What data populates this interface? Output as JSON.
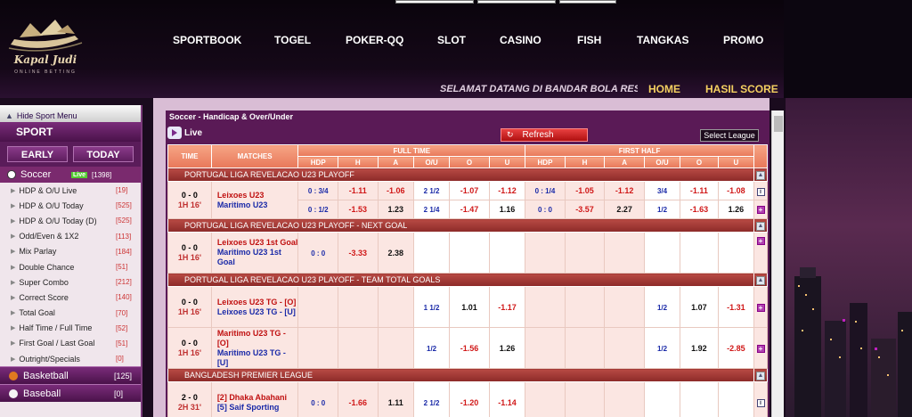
{
  "brand": {
    "name": "Kapal Judi",
    "tagline": "ONLINE BETTING"
  },
  "nav": [
    "SPORTBOOK",
    "TOGEL",
    "POKER-QQ",
    "SLOT",
    "CASINO",
    "FISH",
    "TANGKAS",
    "PROMO"
  ],
  "marquee": "SELAMAT DATANG DI BANDAR BOLA RESMI",
  "header_links": {
    "home": "HOME",
    "results": "HASIL SCORE"
  },
  "sidebar": {
    "hide_label": "Hide Sport Menu",
    "sport_title": "SPORT",
    "tabs": [
      "EARLY",
      "TODAY"
    ],
    "soccer": {
      "label": "Soccer",
      "badge": "Live",
      "count": "[1398]"
    },
    "items": [
      {
        "label": "HDP & O/U Live",
        "count": "[19]"
      },
      {
        "label": "HDP & O/U Today",
        "count": "[525]"
      },
      {
        "label": "HDP & O/U Today (D)",
        "count": "[525]"
      },
      {
        "label": "Odd/Even & 1X2",
        "count": "[113]"
      },
      {
        "label": "Mix Parlay",
        "count": "[184]"
      },
      {
        "label": "Double Chance",
        "count": "[51]"
      },
      {
        "label": "Super Combo",
        "count": "[212]"
      },
      {
        "label": "Correct Score",
        "count": "[140]"
      },
      {
        "label": "Total Goal",
        "count": "[70]"
      },
      {
        "label": "Half Time / Full Time",
        "count": "[52]"
      },
      {
        "label": "First Goal / Last Goal",
        "count": "[51]"
      },
      {
        "label": "Outright/Specials",
        "count": "[0]"
      }
    ],
    "sports": [
      {
        "label": "Basketball",
        "count": "[125]"
      },
      {
        "label": "Baseball",
        "count": "[0]"
      }
    ]
  },
  "main": {
    "title": "Soccer - Handicap & Over/Under",
    "live_label": "Live",
    "refresh": "Refresh",
    "select_league": "Select League",
    "headers": {
      "time": "TIME",
      "matches": "MATCHES",
      "full_time": "FULL TIME",
      "first_half": "FIRST HALF",
      "cols": [
        "HDP",
        "H",
        "A",
        "O/U",
        "O",
        "U"
      ]
    },
    "leagues": [
      "PORTUGAL LIGA REVELACAO U23 PLAYOFF",
      "PORTUGAL LIGA REVELACAO U23 PLAYOFF - NEXT GOAL",
      "PORTUGAL LIGA REVELACAO U23 PLAYOFF - TEAM TOTAL GOALS",
      "BANGLADESH PREMIER LEAGUE"
    ],
    "match1": {
      "score": "0 - 0",
      "time": "1H 16'",
      "home": "Leixoes U23",
      "away": "Maritimo U23",
      "r1": {
        "hdp": "0 : 3/4",
        "h": "-1.11",
        "a": "-1.06",
        "ou": "2 1/2",
        "o": "-1.07",
        "u": "-1.12",
        "fhdp": "0 : 1/4",
        "fh": "-1.05",
        "fa": "-1.12",
        "fou": "3/4",
        "fo": "-1.11",
        "fu": "-1.08"
      },
      "r2": {
        "hdp": "0 : 1/2",
        "h": "-1.53",
        "a": "1.23",
        "ou": "2 1/4",
        "o": "-1.47",
        "u": "1.16",
        "fhdp": "0 : 0",
        "fh": "-3.57",
        "fa": "2.27",
        "fou": "1/2",
        "fo": "-1.63",
        "fu": "1.26"
      }
    },
    "match2": {
      "score": "0 - 0",
      "time": "1H 16'",
      "home": "Leixoes U23 1st Goal",
      "away": "Maritimo U23 1st Goal",
      "hdp": "0 : 0",
      "h": "-3.33",
      "a": "2.38"
    },
    "match3": {
      "a": {
        "score": "0 - 0",
        "time": "1H 16'",
        "home": "Leixoes U23 TG - [O]",
        "away": "Leixoes U23 TG - [U]",
        "ou": "1 1/2",
        "o": "1.01",
        "u": "-1.17",
        "fou": "1/2",
        "fo": "1.07",
        "fu": "-1.31"
      },
      "b": {
        "score": "0 - 0",
        "time": "1H 16'",
        "home": "Maritimo U23 TG - [O]",
        "away": "Maritimo U23 TG - [U]",
        "ou": "1/2",
        "o": "-1.56",
        "u": "1.26",
        "fou": "1/2",
        "fo": "1.92",
        "fu": "-2.85"
      }
    },
    "match4": {
      "score": "2 - 0",
      "time": "2H 31'",
      "home": "[2] Dhaka Abahani",
      "away": "[5] Saif Sporting",
      "hdp": "0 : 0",
      "h": "-1.66",
      "a": "1.11",
      "ou": "2 1/2",
      "o": "-1.20",
      "u": "-1.14"
    }
  },
  "colors": {
    "accent": "#5a1a56",
    "header_orange": "#e8785a",
    "league_red": "#8c2a28",
    "negative": "#d01818",
    "hdp_blue": "#1a2aa8"
  }
}
